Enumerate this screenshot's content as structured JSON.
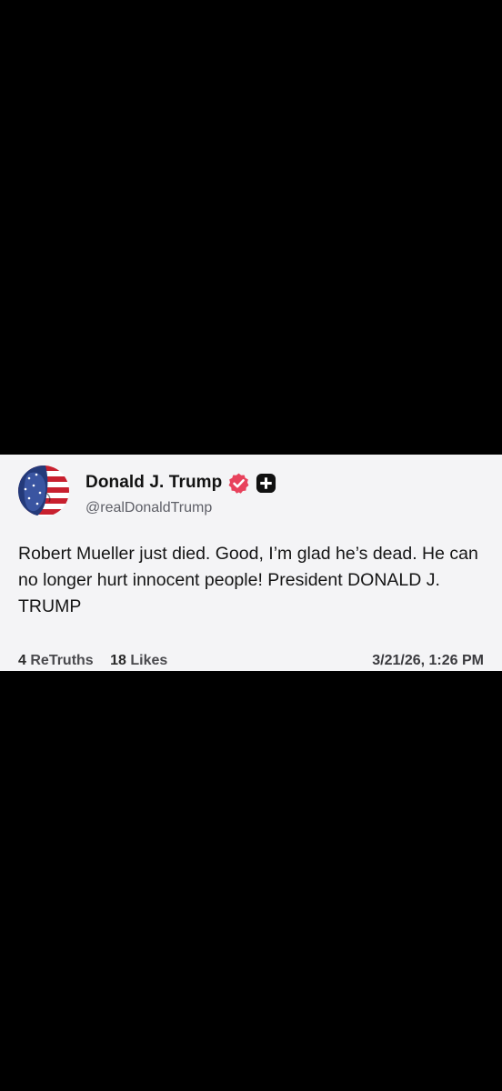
{
  "post": {
    "author": {
      "display_name": "Donald J. Trump",
      "handle": "@realDonaldTrump",
      "verified_icon": "verified-badge-icon",
      "badge_icon": "plus-badge-icon",
      "verified_color": "#e8425c"
    },
    "text": "Robert Mueller just died. Good, I’m glad he’s dead. He can no longer hurt innocent people! President DONALD J. TRUMP",
    "stats": {
      "retruths_count": "4",
      "retruths_label": "ReTruths",
      "likes_count": "18",
      "likes_label": "Likes"
    },
    "timestamp": "3/21/26, 1:26 PM"
  }
}
